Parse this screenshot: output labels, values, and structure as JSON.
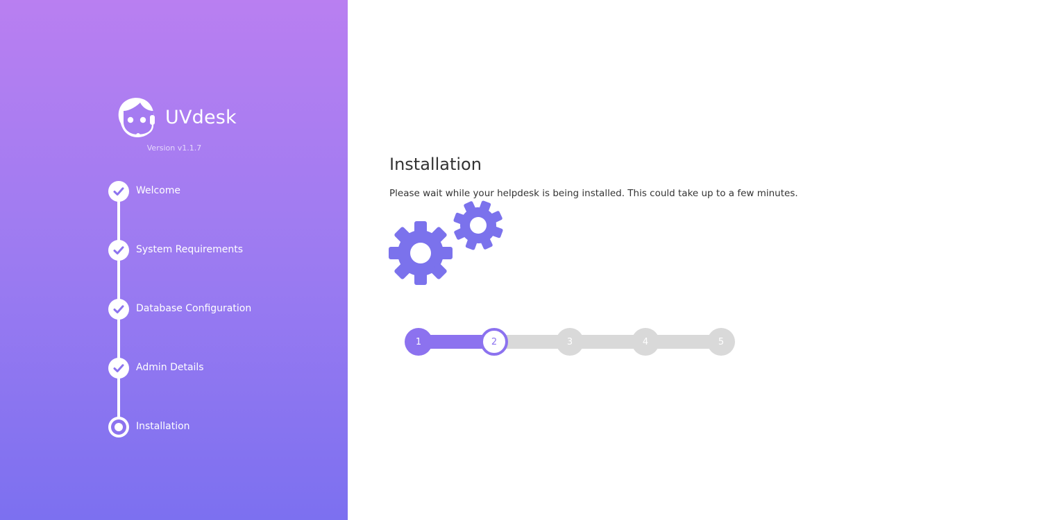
{
  "sidebar": {
    "brand_name": "UVdesk",
    "version": "Version v1.1.7",
    "steps": [
      {
        "label": "Welcome",
        "state": "completed"
      },
      {
        "label": "System Requirements",
        "state": "completed"
      },
      {
        "label": "Database Configuration",
        "state": "completed"
      },
      {
        "label": "Admin Details",
        "state": "completed"
      },
      {
        "label": "Installation",
        "state": "current"
      }
    ]
  },
  "main": {
    "title": "Installation",
    "message": "Please wait while your helpdesk is being installed. This could take up to a few minutes.",
    "progress": {
      "steps": [
        "1",
        "2",
        "3",
        "4",
        "5"
      ],
      "current": 2,
      "completed_fraction": 0.25
    }
  },
  "colors": {
    "accent": "#8c72ef",
    "sidebar_gradient_top": "#b97ff1",
    "sidebar_gradient_bottom": "#7c70f0",
    "inactive": "#d9d9d9"
  },
  "icons": {
    "logo": "headset-agent-icon",
    "check": "check-icon",
    "gears": "gears-icon"
  }
}
